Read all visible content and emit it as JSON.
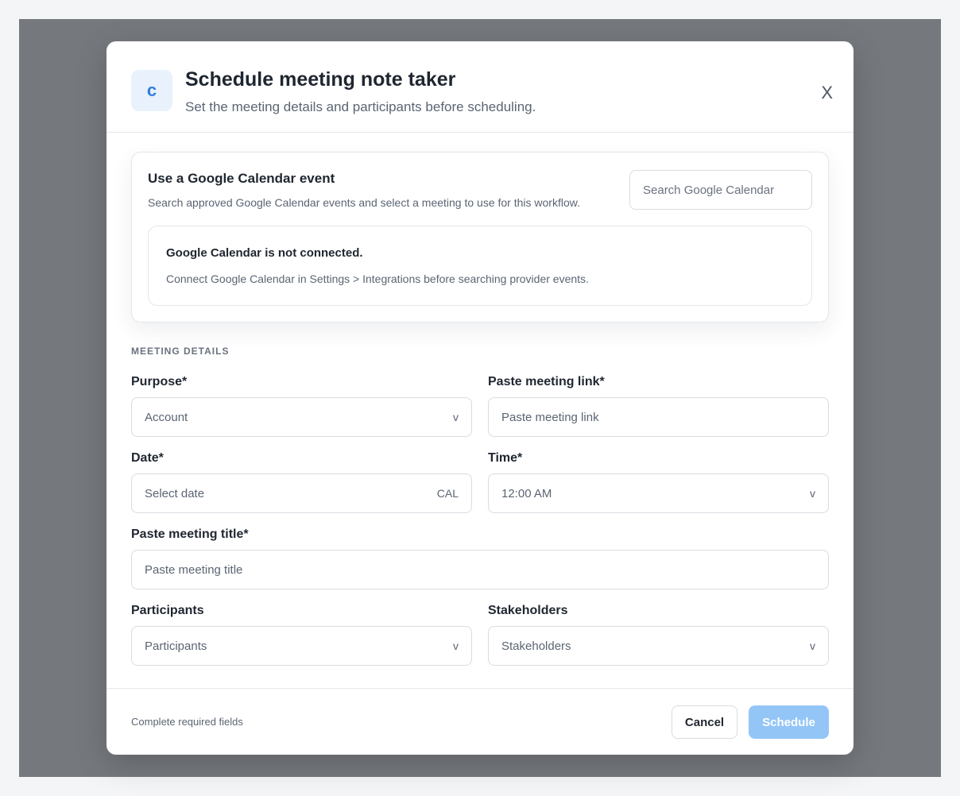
{
  "modal": {
    "logo_letter": "c",
    "title": "Schedule meeting note taker",
    "subtitle": "Set the meeting details and participants before scheduling.",
    "close_label": "X"
  },
  "gcal": {
    "title": "Use a Google Calendar event",
    "description": "Search approved Google Calendar events and select a meeting to use for this workflow.",
    "search_placeholder": "Search Google Calendar",
    "notice_title": "Google Calendar is not connected.",
    "notice_description": "Connect Google Calendar in Settings > Integrations before searching provider events."
  },
  "details": {
    "section_label": "MEETING DETAILS",
    "purpose": {
      "label": "Purpose*",
      "value": "Account",
      "chevron": "v"
    },
    "link": {
      "label": "Paste meeting link*",
      "placeholder": "Paste meeting link"
    },
    "date": {
      "label": "Date*",
      "placeholder": "Select date",
      "icon_text": "CAL"
    },
    "time": {
      "label": "Time*",
      "value": "12:00 AM",
      "chevron": "v"
    },
    "title": {
      "label": "Paste meeting title*",
      "placeholder": "Paste meeting title"
    },
    "participants": {
      "label": "Participants",
      "placeholder": "Participants",
      "chevron": "v"
    },
    "stakeholders": {
      "label": "Stakeholders",
      "placeholder": "Stakeholders",
      "chevron": "v"
    }
  },
  "footer": {
    "note": "Complete required fields",
    "cancel_label": "Cancel",
    "schedule_label": "Schedule"
  },
  "colors": {
    "accent": "#2f7fdc",
    "schedule_disabled": "#93c5f7",
    "overlay": "#75787d"
  }
}
